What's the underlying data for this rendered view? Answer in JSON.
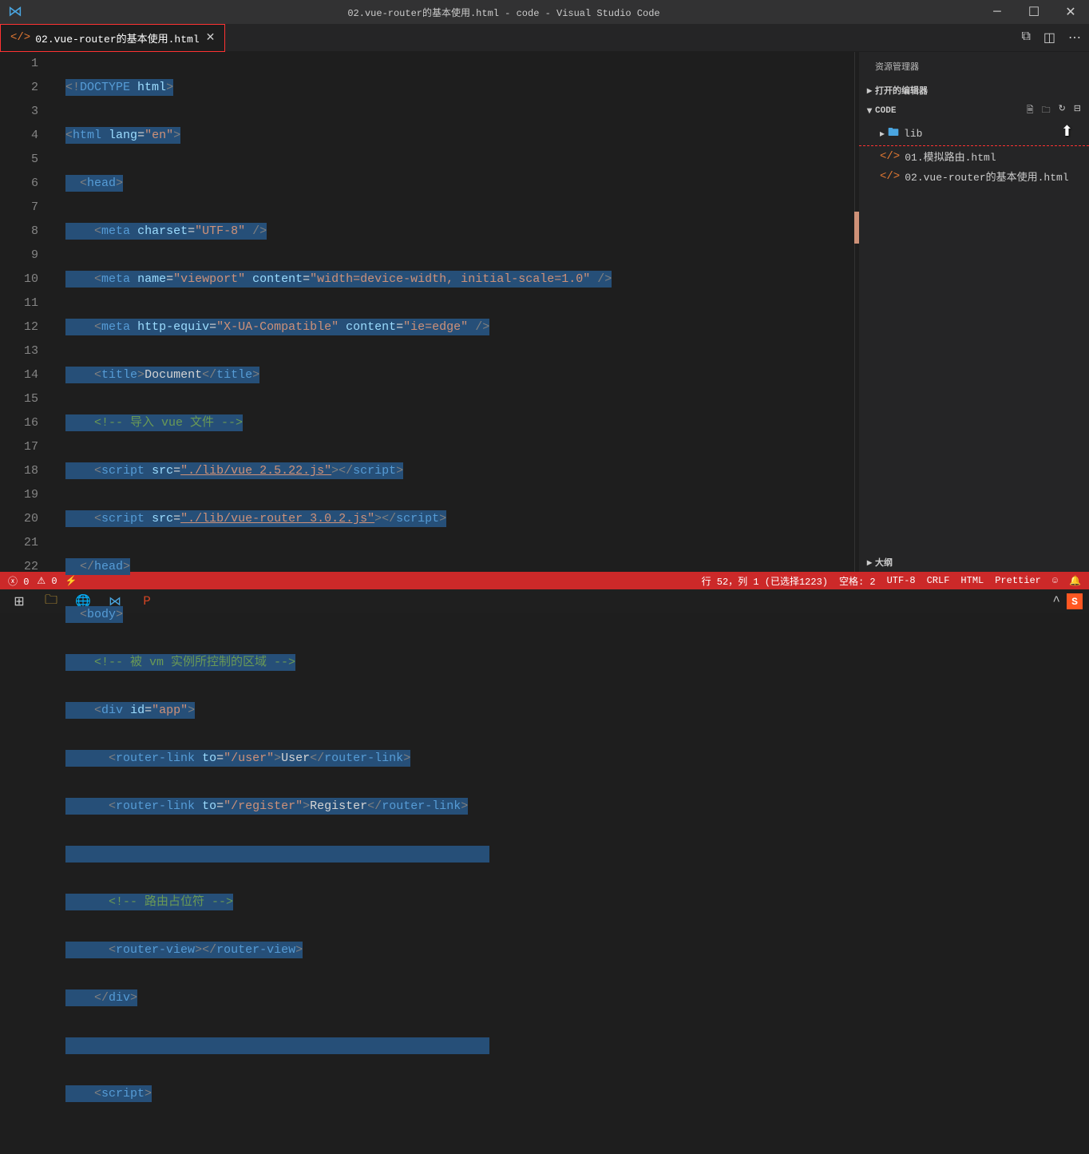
{
  "titlebar": {
    "title": "02.vue-router的基本使用.html - code - Visual Studio Code"
  },
  "tab": {
    "label": "02.vue-router的基本使用.html"
  },
  "sidebar": {
    "title": "资源管理器",
    "open_editors": "打开的编辑器",
    "code_section": "CODE",
    "folder": "lib",
    "file1": "01.模拟路由.html",
    "file2": "02.vue-router的基本使用.html",
    "outline": "大纲"
  },
  "status": {
    "errors": "0",
    "warnings": "0",
    "cursor": "行 52，列 1 (已选择1223)",
    "spaces": "空格: 2",
    "encoding": "UTF-8",
    "eol": "CRLF",
    "lang": "HTML",
    "prettier": "Prettier"
  },
  "code": {
    "l1_doctype": "DOCTYPE",
    "l1_html": "html",
    "l2_html": "html",
    "l2_lang": "lang",
    "l2_en": "\"en\"",
    "l3_head": "head",
    "l4_meta": "meta",
    "l4_charset": "charset",
    "l4_utf8": "\"UTF-8\"",
    "l5_meta": "meta",
    "l5_name": "name",
    "l5_viewport": "\"viewport\"",
    "l5_content": "content",
    "l5_cvalue": "\"width=device-width, initial-scale=1.0\"",
    "l6_meta": "meta",
    "l6_httpequiv": "http-equiv",
    "l6_xua": "\"X-UA-Compatible\"",
    "l6_content": "content",
    "l6_ie": "\"ie=edge\"",
    "l7_title": "title",
    "l7_doc": "Document",
    "l8_comment": "<!-- 导入 vue 文件 -->",
    "l9_script": "script",
    "l9_src": "src",
    "l9_path": "\"./lib/vue_2.5.22.js\"",
    "l10_script": "script",
    "l10_src": "src",
    "l10_path": "\"./lib/vue-router_3.0.2.js\"",
    "l11_head": "head",
    "l12_body": "body",
    "l13_comment": "<!-- 被 vm 实例所控制的区域 -->",
    "l14_div": "div",
    "l14_id": "id",
    "l14_app": "\"app\"",
    "l15_rl": "router-link",
    "l15_to": "to",
    "l15_user": "\"/user\"",
    "l15_usertxt": "User",
    "l16_rl": "router-link",
    "l16_to": "to",
    "l16_reg": "\"/register\"",
    "l16_regtxt": "Register",
    "l18_comment": "<!-- 路由占位符 -->",
    "l19_rv": "router-view",
    "l20_div": "div",
    "l22_script": "script"
  },
  "lines": [
    "1",
    "2",
    "3",
    "4",
    "5",
    "6",
    "7",
    "8",
    "9",
    "10",
    "11",
    "12",
    "13",
    "14",
    "15",
    "16",
    "17",
    "18",
    "19",
    "20",
    "21",
    "22"
  ]
}
